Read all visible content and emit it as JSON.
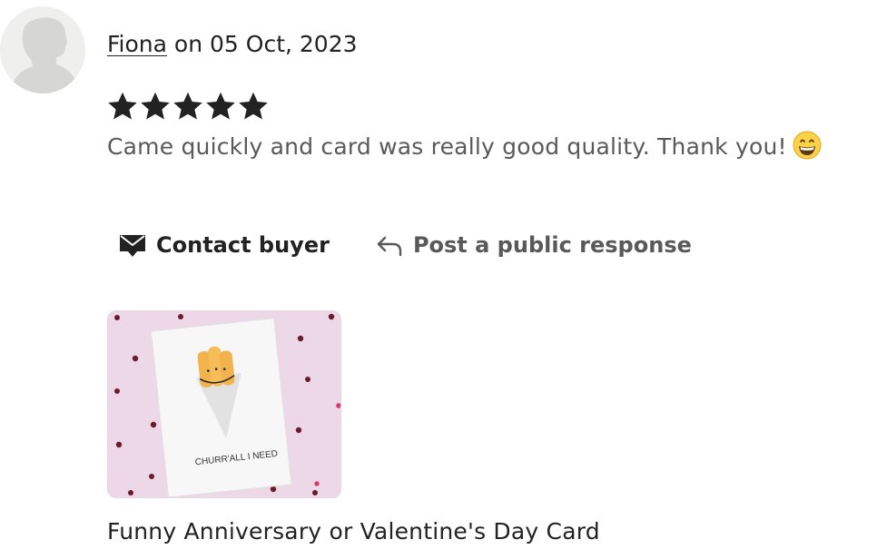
{
  "review": {
    "author": "Fiona",
    "date_text": "on 05 Oct, 2023",
    "rating": 5,
    "rating_max": 5,
    "text": "Came quickly and card was really good quality. Thank you!",
    "emoji_icon": "grinning-face-icon"
  },
  "actions": {
    "contact_label": "Contact buyer",
    "public_response_label": "Post a public response"
  },
  "product": {
    "card_text": "CHURR'ALL I NEED",
    "title": "Funny Anniversary or Valentine's Day Card"
  },
  "colors": {
    "text": "#222222",
    "muted": "#595959",
    "thumbnail_background": "#ecd8e6",
    "heart": "#6b1c2c"
  }
}
